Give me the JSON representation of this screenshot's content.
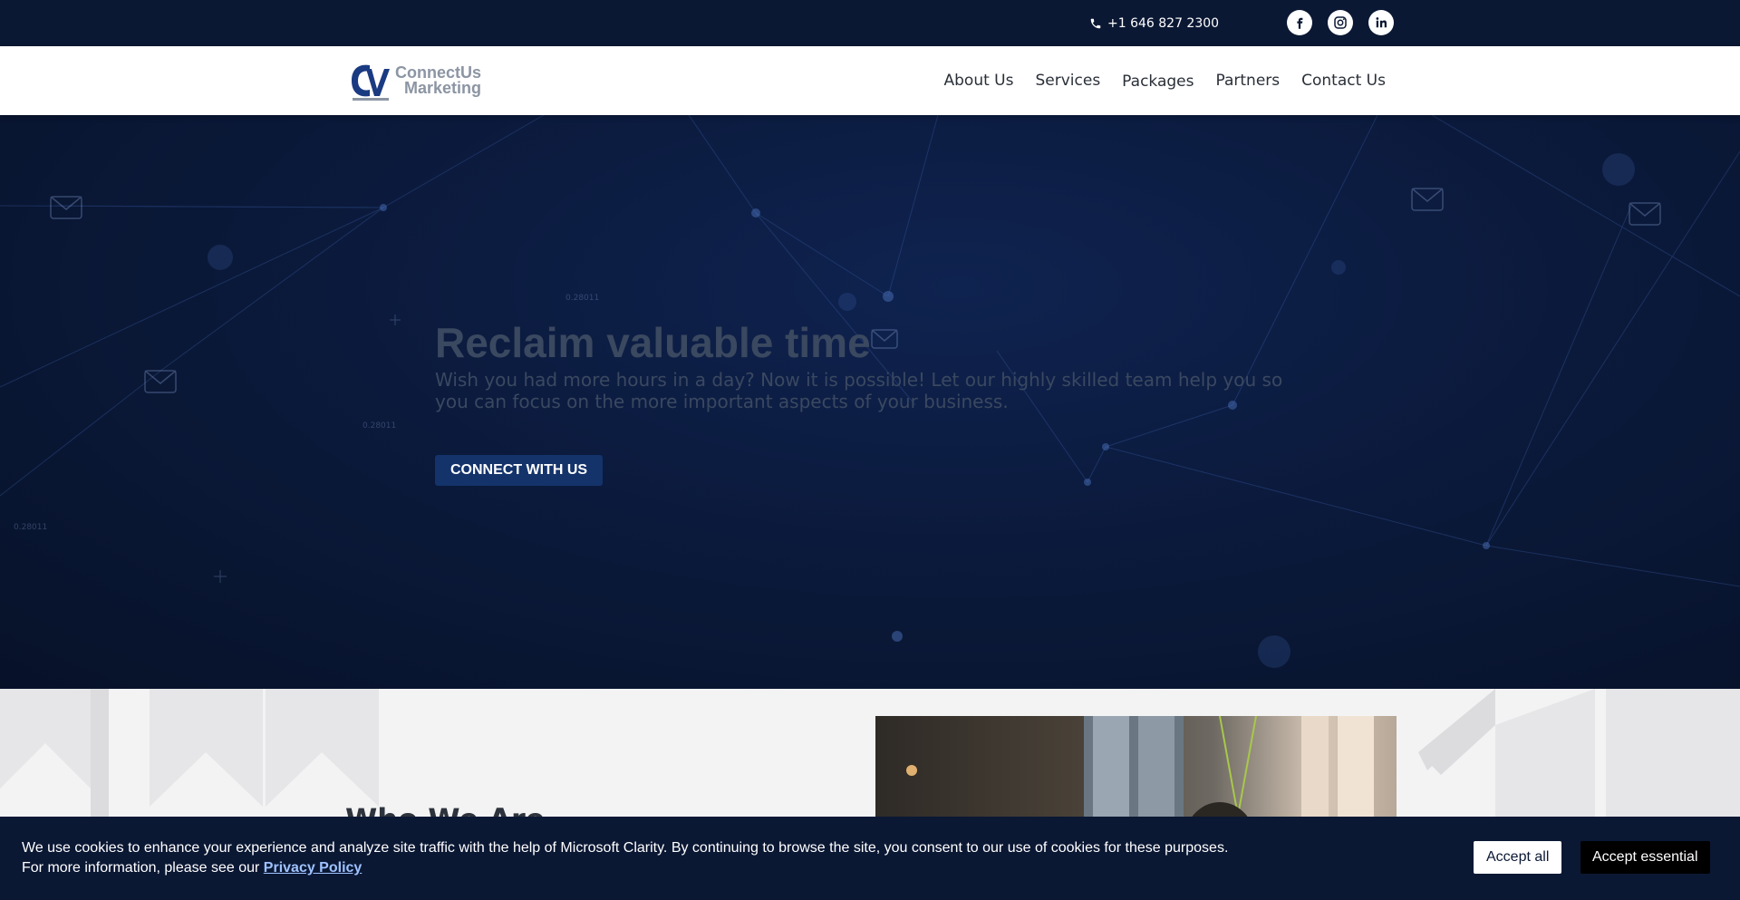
{
  "topbar": {
    "phone": "+1 646 827 2300",
    "social": [
      {
        "name": "facebook-icon"
      },
      {
        "name": "instagram-icon"
      },
      {
        "name": "linkedin-icon"
      }
    ]
  },
  "header": {
    "logo_line1": "ConnectUs",
    "logo_line2": "Marketing",
    "nav": [
      "About Us",
      "Services",
      "Packages",
      "Partners",
      "Contact Us"
    ]
  },
  "hero": {
    "title": "Reclaim valuable time",
    "subtitle": "Wish you had more hours in a day? Now it is possible! Let our highly skilled team help you so you can focus on the more important aspects of your business.",
    "cta": "CONNECT WITH US"
  },
  "about": {
    "heading": "Who We Are"
  },
  "cookie": {
    "text": "We use cookies to enhance your experience and analyze site traffic with the help of Microsoft Clarity. By continuing to browse the site, you consent to our use of cookies for these purposes. For more information, please see our",
    "link": "Privacy Policy",
    "accept_all": "Accept all",
    "accept_essential": "Accept essential"
  },
  "colors": {
    "navy": "#0b1834",
    "cta": "#14336b",
    "white": "#ffffff"
  }
}
